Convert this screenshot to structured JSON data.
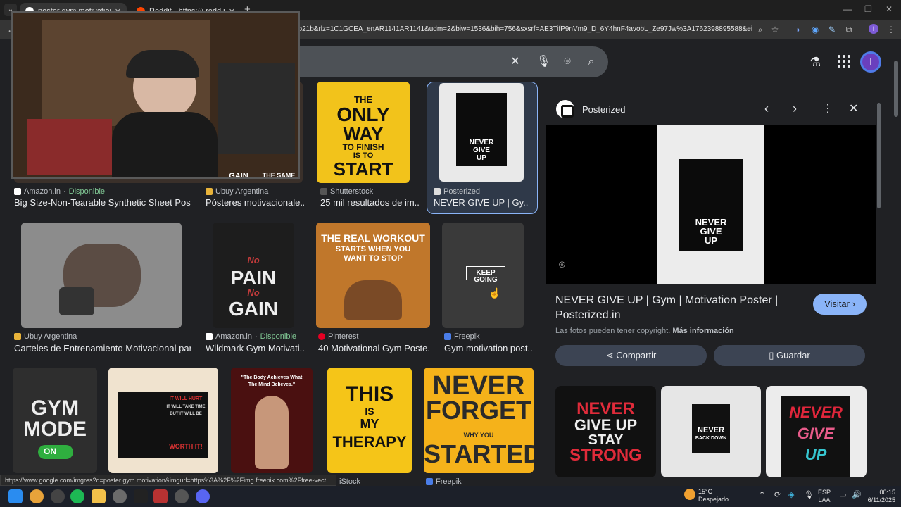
{
  "browser": {
    "tabs": [
      {
        "title": "poster gym motivation - Buscar",
        "active": true
      },
      {
        "title": "Reddit - https://i.redd.it/d2736",
        "active": false
      }
    ],
    "url": "3b21b&rlz=1C1GCEA_enAR1141AR1141&udm=2&biw=1536&bih=756&sxsrf=AE3TifP9nVm9_D_6Y4hnF4avobL_Ze97Jw%3A1762398895588&ei=rxlMafn...",
    "status_url": "https://www.google.com/imgres?q=poster gym motivation&imgurl=https%3A%2F%2Fimg.freepik.com%2Ffree-vect..."
  },
  "results_row1": [
    {
      "source": "Amazon.in",
      "availability": "Disponible",
      "title": "Big Size-Non-Tearable Synthetic Sheet Post..."
    },
    {
      "source": "Ubuy Argentina",
      "title": "Pósteres motivacionale..."
    },
    {
      "source": "Shutterstock",
      "title": "25 mil resultados de im...",
      "poster_lines": [
        "THE",
        "ONLY",
        "WAY",
        "TO FINISH",
        "IS TO",
        "START"
      ]
    },
    {
      "source": "Posterized",
      "title": "NEVER GIVE UP | Gy...",
      "poster_lines": [
        "NEVER",
        "GIVE",
        "UP"
      ]
    }
  ],
  "webcam_caption_fragments": [
    "GAIN",
    "THE SAME"
  ],
  "results_row2": [
    {
      "source": "Ubuy Argentina",
      "title": "Carteles de Entrenamiento Motivacional par..."
    },
    {
      "source": "Amazon.in",
      "availability": "Disponible",
      "title": "Wildmark Gym Motivati...",
      "poster_lines": [
        "No",
        "PAIN",
        "No",
        "GAIN"
      ]
    },
    {
      "source": "Pinterest",
      "title": "40 Motivational Gym Poste...",
      "poster_lines": [
        "THE REAL WORKOUT",
        "STARTS WHEN YOU",
        "WANT TO STOP"
      ]
    },
    {
      "source": "Freepik",
      "title": "Gym motivation post...",
      "poster_lines": [
        "KEEP GOING"
      ]
    }
  ],
  "results_row3": [
    {
      "poster_lines": [
        "GYM",
        "MODE",
        "ON"
      ]
    },
    {
      "poster_lines": [
        "IT WILL HURT",
        "IT WILL TAKE TIME",
        "BUT IT WILL BE",
        "WORTH IT!"
      ]
    },
    {
      "poster_lines": [
        "\"The Body Achieves What",
        "The Mind Believes.\""
      ]
    },
    {
      "poster_lines": [
        "THIS",
        "IS",
        "MY",
        "THERAPY"
      ]
    },
    {
      "poster_lines": [
        "NEVER",
        "FORGET",
        "WHY YOU",
        "STARTED"
      ]
    }
  ],
  "results_row4_sources": [
    "iStock",
    "Freepik"
  ],
  "panel": {
    "site": "Posterized",
    "image_text": [
      "NEVER",
      "GIVE",
      "UP"
    ],
    "title": "NEVER GIVE UP | Gym | Motivation Poster | Posterized.in",
    "visit_label": "Visitar",
    "copyright_text": "Las fotos pueden tener copyright.",
    "more_info": "Más información",
    "share_label": "Compartir",
    "save_label": "Guardar",
    "related": [
      [
        "NEVER",
        "GIVE UP",
        "STAY",
        "STRONG"
      ],
      [
        "NEVER",
        "BACK DOWN"
      ],
      [
        "NEVER",
        "GIVE",
        "UP"
      ]
    ]
  },
  "taskbar": {
    "weather_temp": "15°C",
    "weather_desc": "Despejado",
    "lang_top": "ESP",
    "lang_bottom": "LAA",
    "time": "00:15",
    "date": "6/11/2025"
  },
  "colors": {
    "page_bg": "#202124",
    "accent": "#8ab4f8",
    "available_green": "#81c995",
    "poster_yellow": "#f5c518"
  }
}
